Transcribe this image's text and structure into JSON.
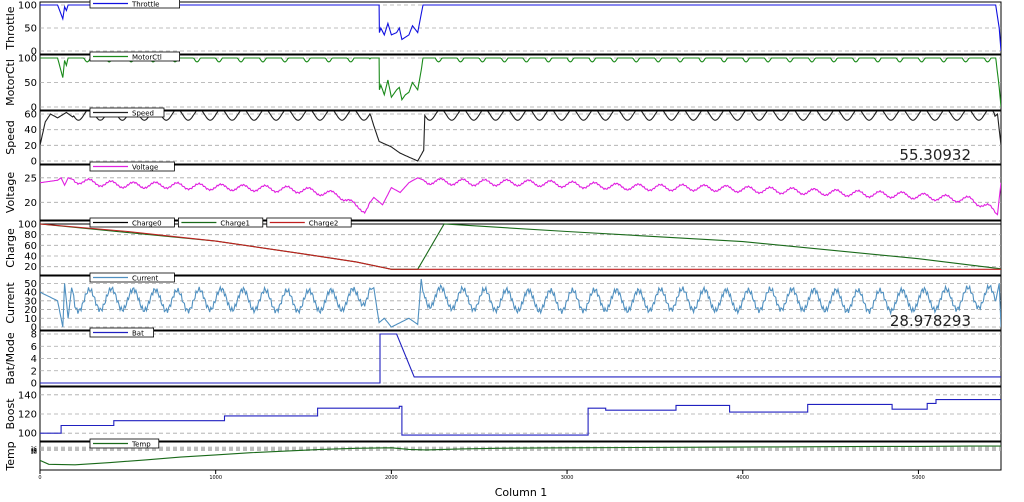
{
  "window": {
    "x_axis_label": "Column 1"
  },
  "x_ticks": [
    "0",
    "1000",
    "2000",
    "3000",
    "4000",
    "5000"
  ],
  "colors": {
    "frame": "#000000",
    "grid": "#a8a8a8",
    "background": "#ffffff"
  },
  "chart_data": [
    {
      "type": "line",
      "ylabel": "Throttle",
      "ylim": [
        0,
        100
      ],
      "yticks": [
        "0",
        "50",
        "100"
      ],
      "series": [
        {
          "name": "Throttle",
          "color": "#1010e0",
          "x": [
            0,
            100,
            130,
            140,
            150,
            160,
            170,
            180,
            1930,
            1932,
            1940,
            1960,
            1980,
            2000,
            2030,
            2045,
            2060,
            2080,
            2100,
            2120,
            2150,
            2170,
            2180,
            5000,
            5200,
            5400,
            5440,
            5460,
            5470
          ],
          "y": [
            100,
            100,
            70,
            96,
            88,
            100,
            100,
            100,
            100,
            40,
            50,
            35,
            60,
            35,
            40,
            50,
            25,
            30,
            35,
            55,
            40,
            80,
            100,
            100,
            100,
            100,
            100,
            50,
            0
          ]
        }
      ]
    },
    {
      "type": "line",
      "ylabel": "MotorCtl",
      "ylim": [
        0,
        100
      ],
      "yticks": [
        "0",
        "50",
        "100"
      ],
      "series": [
        {
          "name": "MotorCtl",
          "color": "#1a8a1a",
          "x": [
            0,
            100,
            130,
            140,
            150,
            160,
            170,
            180,
            1930,
            1932,
            1940,
            1960,
            1980,
            2000,
            2030,
            2045,
            2060,
            2080,
            2100,
            2120,
            2150,
            2170,
            2180,
            5000,
            5200,
            5400,
            5440,
            5460,
            5470
          ],
          "y": [
            100,
            100,
            60,
            95,
            85,
            100,
            100,
            100,
            100,
            35,
            45,
            25,
            55,
            20,
            35,
            40,
            15,
            25,
            30,
            50,
            35,
            75,
            100,
            100,
            100,
            100,
            100,
            40,
            0
          ],
          "ripple_dip": 8,
          "ripple_period": 125
        }
      ]
    },
    {
      "type": "line",
      "ylabel": "Speed",
      "ylim": [
        0,
        60
      ],
      "yticks": [
        "0",
        "20",
        "40",
        "60"
      ],
      "readout": "55.30932",
      "series": [
        {
          "name": "Speed",
          "color": "#202020",
          "x": [
            0,
            30,
            60,
            100,
            150,
            200,
            300,
            400,
            500,
            600,
            700,
            800,
            900,
            1000,
            1100,
            1200,
            1300,
            1400,
            1500,
            1600,
            1700,
            1800,
            1850,
            1880,
            1900,
            1930,
            1960,
            2000,
            2050,
            2100,
            2150,
            2200,
            2250,
            2300,
            2400,
            2500,
            2600,
            2700,
            2800,
            2900,
            3000,
            3100,
            3200,
            3300,
            3400,
            3500,
            3600,
            3700,
            3800,
            3900,
            4000,
            4100,
            4200,
            4300,
            4400,
            4500,
            4600,
            4700,
            4800,
            4900,
            5000,
            5100,
            5200,
            5300,
            5400,
            5450,
            5470
          ],
          "y": [
            20,
            50,
            60,
            55,
            62,
            54,
            64,
            52,
            66,
            52,
            66,
            52,
            66,
            52,
            66,
            52,
            66,
            52,
            66,
            52,
            66,
            52,
            66,
            60,
            45,
            25,
            22,
            18,
            10,
            5,
            0,
            20,
            50,
            62,
            52,
            66,
            52,
            66,
            52,
            66,
            52,
            66,
            52,
            66,
            52,
            66,
            52,
            66,
            52,
            66,
            52,
            66,
            52,
            66,
            52,
            66,
            52,
            66,
            52,
            66,
            52,
            66,
            52,
            66,
            50,
            60,
            20
          ],
          "oscillation": {
            "center": 59,
            "amplitude": 7,
            "period": 125
          }
        }
      ]
    },
    {
      "type": "line",
      "ylabel": "Voltage",
      "ylim": [
        17,
        27
      ],
      "yticks": [
        "20",
        "25"
      ],
      "series": [
        {
          "name": "Voltage",
          "color": "#e020e0",
          "x": [
            0,
            100,
            120,
            140,
            160,
            200,
            300,
            500,
            700,
            900,
            1100,
            1300,
            1500,
            1600,
            1700,
            1750,
            1800,
            1850,
            1900,
            1950,
            2000,
            2050,
            2100,
            2150,
            2200,
            2300,
            2500,
            2700,
            2900,
            3100,
            3300,
            3500,
            3700,
            3900,
            4100,
            4300,
            4500,
            4700,
            4900,
            5100,
            5300,
            5400,
            5450,
            5470
          ],
          "y": [
            24,
            24.5,
            25,
            23.5,
            25,
            24.5,
            24,
            23.5,
            23.5,
            23.2,
            23,
            22.8,
            22.5,
            22,
            21.5,
            20.5,
            19,
            18.5,
            21,
            19.5,
            23,
            22,
            24,
            25,
            24.3,
            24.2,
            24,
            24,
            23.8,
            23.5,
            23.2,
            23,
            23,
            22.8,
            22.5,
            22.3,
            22,
            21.7,
            21.5,
            21,
            20.5,
            19,
            17.5,
            24
          ],
          "ripple_amplitude": 0.6,
          "ripple_period": 125
        }
      ]
    },
    {
      "type": "line",
      "ylabel": "Charge",
      "ylim": [
        10,
        100
      ],
      "yticks": [
        "20",
        "40",
        "60",
        "80",
        "100"
      ],
      "series": [
        {
          "name": "Charge0",
          "color": "#000000",
          "x": [
            0,
            5470
          ],
          "y": [
            100,
            100
          ]
        },
        {
          "name": "Charge1",
          "color": "#1a6a1a",
          "x": [
            0,
            1000,
            1500,
            1800,
            2000,
            2150,
            2300,
            3000,
            4000,
            5000,
            5470
          ],
          "y": [
            100,
            68,
            44,
            29,
            15,
            15,
            100,
            86,
            67,
            35,
            16
          ]
        },
        {
          "name": "Charge2",
          "color": "#c02020",
          "x": [
            0,
            500,
            1000,
            1500,
            1800,
            2000,
            2150,
            2300,
            5470
          ],
          "y": [
            100,
            86,
            68,
            44,
            29,
            15,
            15,
            15,
            15
          ]
        }
      ]
    },
    {
      "type": "line",
      "ylabel": "Current",
      "ylim": [
        0,
        55
      ],
      "yticks": [
        "0",
        "10",
        "20",
        "30",
        "40",
        "50"
      ],
      "readout": "28.978293",
      "series": [
        {
          "name": "Current",
          "color": "#5090c0",
          "x": [
            0,
            100,
            130,
            140,
            160,
            180,
            200,
            400,
            600,
            800,
            1000,
            1200,
            1400,
            1600,
            1800,
            1900,
            1930,
            1960,
            2000,
            2050,
            2100,
            2150,
            2170,
            2180,
            2200,
            2400,
            2600,
            2800,
            3000,
            3200,
            3400,
            3600,
            3800,
            4000,
            4200,
            4400,
            4600,
            4800,
            5000,
            5200,
            5400,
            5440,
            5460,
            5470
          ],
          "y": [
            40,
            30,
            0,
            50,
            10,
            45,
            30,
            32,
            31,
            30,
            32,
            31,
            30,
            30,
            32,
            45,
            5,
            10,
            0,
            5,
            10,
            3,
            55,
            40,
            35,
            32,
            31,
            30,
            30,
            31,
            30,
            32,
            31,
            30,
            32,
            31,
            30,
            30,
            31,
            32,
            35,
            30,
            50,
            0
          ],
          "ripple_amplitude": 12,
          "ripple_period": 125
        }
      ]
    },
    {
      "type": "line",
      "ylabel": "Bat/Mode",
      "ylim": [
        0,
        8
      ],
      "yticks": [
        "0",
        "2",
        "4",
        "6",
        "8"
      ],
      "series": [
        {
          "name": "Bat",
          "color": "#2020c0",
          "x": [
            0,
            1935,
            1935,
            2030,
            2130,
            5470
          ],
          "y": [
            0,
            0,
            8,
            8,
            1,
            1
          ]
        }
      ]
    },
    {
      "type": "line",
      "ylabel": "Boost",
      "ylim": [
        95,
        145
      ],
      "yticks": [
        "100",
        "120",
        "140"
      ],
      "series": [
        {
          "name": "",
          "color": "#2020c0",
          "x": [
            0,
            120,
            120,
            420,
            420,
            1050,
            1050,
            1580,
            1580,
            2045,
            2045,
            2060,
            2060,
            2110,
            2110,
            3120,
            3120,
            3220,
            3220,
            3620,
            3620,
            3925,
            3925,
            4370,
            4370,
            4850,
            4850,
            5050,
            5050,
            5100,
            5100,
            5470
          ],
          "y": [
            100,
            100,
            108,
            108,
            113,
            113,
            118,
            118,
            126,
            126,
            128,
            128,
            98,
            98,
            98,
            98,
            126,
            126,
            124,
            124,
            129,
            129,
            122,
            122,
            130,
            130,
            125,
            125,
            131,
            131,
            135,
            135
          ]
        }
      ]
    },
    {
      "type": "line",
      "ylabel": "Temp",
      "ylim": [
        0,
        40
      ],
      "yticks": [
        "30",
        "32",
        "34",
        "36"
      ],
      "series": [
        {
          "name": "Temp",
          "color": "#1a6a1a",
          "x": [
            0,
            50,
            200,
            400,
            600,
            800,
            1000,
            1200,
            1400,
            1600,
            1800,
            2000,
            2100,
            2200,
            2400,
            2600,
            3000,
            3400,
            3800,
            4200,
            4600,
            5000,
            5300,
            5470
          ],
          "y": [
            12,
            5,
            4,
            8,
            13,
            18,
            22,
            26,
            29,
            32,
            34,
            35,
            32,
            31,
            33,
            34,
            35,
            35.5,
            36,
            36.5,
            37,
            37.5,
            38,
            38
          ]
        }
      ]
    }
  ]
}
